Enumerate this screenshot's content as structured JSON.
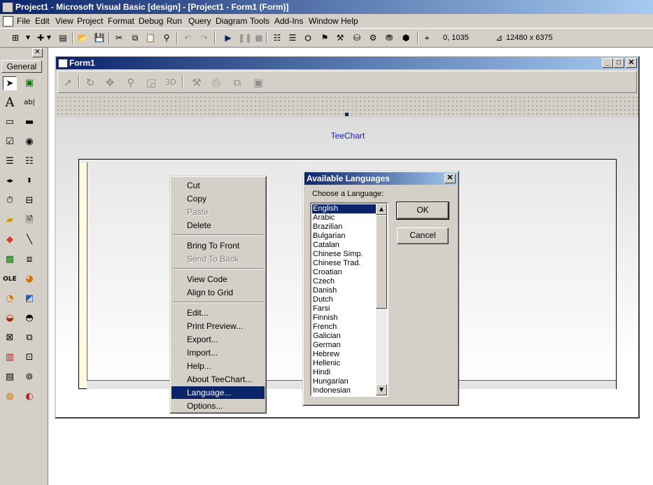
{
  "window": {
    "title": "Project1 - Microsoft Visual Basic [design] - [Project1 - Form1 (Form)]"
  },
  "menu": [
    "File",
    "Edit",
    "View",
    "Project",
    "Format",
    "Debug",
    "Run",
    "Query",
    "Diagram",
    "Tools",
    "Add-Ins",
    "Window",
    "Help"
  ],
  "toolbar": {
    "position": "0, 1035",
    "size": "12480 x 6375"
  },
  "toolbox": {
    "tab": "General"
  },
  "form": {
    "title": "Form1"
  },
  "chart": {
    "title": "TeeChart"
  },
  "context_menu": {
    "items": [
      "Cut",
      "Copy",
      "Paste",
      "Delete",
      "Bring To Front",
      "Send To Back",
      "View Code",
      "Align to Grid",
      "Edit...",
      "Print Preview...",
      "Export...",
      "Import...",
      "Help...",
      "About TeeChart...",
      "Language...",
      "Options..."
    ],
    "disabled": [
      "Paste",
      "Send To Back"
    ],
    "highlighted": "Language..."
  },
  "dialog": {
    "title": "Available Languages",
    "label": "Choose a Language:",
    "languages": [
      "English",
      "Arabic",
      "Brazilian",
      "Bulgarian",
      "Catalan",
      "Chinese Simp.",
      "Chinese Trad.",
      "Croatian",
      "Czech",
      "Danish",
      "Dutch",
      "Farsi",
      "Finnish",
      "French",
      "Galician",
      "German",
      "Hebrew",
      "Hellenic",
      "Hindi",
      "Hungarian",
      "Indonesian"
    ],
    "selected": "English",
    "ok_label": "OK",
    "cancel_label": "Cancel"
  },
  "colors": {
    "title_active": "#0a246a",
    "face": "#d4d0c8",
    "chart_title": "#2020c0"
  }
}
